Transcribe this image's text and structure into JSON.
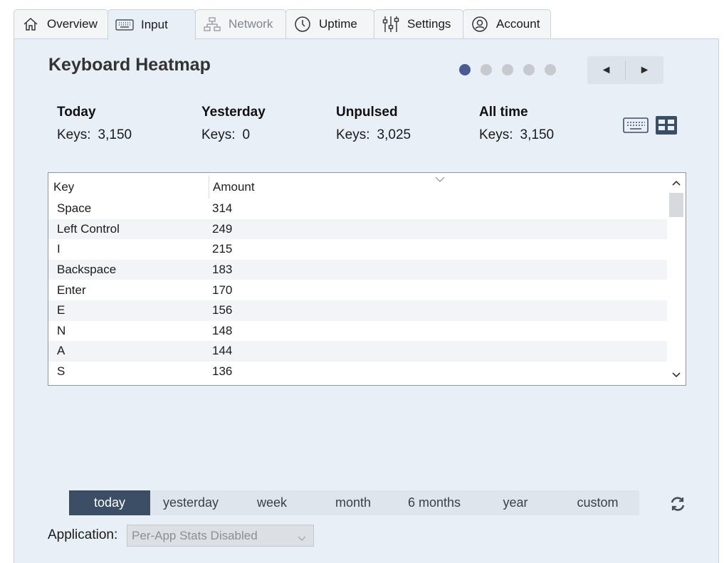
{
  "tabs": [
    {
      "label": "Overview",
      "icon": "home-icon",
      "state": "normal"
    },
    {
      "label": "Input",
      "icon": "keyboard-icon",
      "state": "active"
    },
    {
      "label": "Network",
      "icon": "network-icon",
      "state": "disabled"
    },
    {
      "label": "Uptime",
      "icon": "clock-icon",
      "state": "normal"
    },
    {
      "label": "Settings",
      "icon": "sliders-icon",
      "state": "normal"
    },
    {
      "label": "Account",
      "icon": "user-icon",
      "state": "normal"
    }
  ],
  "page": {
    "title": "Keyboard Heatmap",
    "pager_dots": {
      "count": 5,
      "active_index": 0
    },
    "prev_label": "◄",
    "next_label": "►"
  },
  "stats": [
    {
      "heading": "Today",
      "label": "Keys:",
      "value": "3,150"
    },
    {
      "heading": "Yesterday",
      "label": "Keys:",
      "value": "0"
    },
    {
      "heading": "Unpulsed",
      "label": "Keys:",
      "value": "3,025"
    },
    {
      "heading": "All time",
      "label": "Keys:",
      "value": "3,150"
    }
  ],
  "view_toggle": {
    "keyboard_view_icon": "keyboard-icon",
    "table_view_icon": "grid-icon",
    "active": "table"
  },
  "table": {
    "columns": [
      "Key",
      "Amount"
    ],
    "sort_column": "Amount",
    "sort_direction": "descending",
    "rows": [
      {
        "key": "Space",
        "amount": "314"
      },
      {
        "key": "Left Control",
        "amount": "249"
      },
      {
        "key": "I",
        "amount": "215"
      },
      {
        "key": "Backspace",
        "amount": "183"
      },
      {
        "key": "Enter",
        "amount": "170"
      },
      {
        "key": "E",
        "amount": "156"
      },
      {
        "key": "N",
        "amount": "148"
      },
      {
        "key": "A",
        "amount": "144"
      },
      {
        "key": "S",
        "amount": "136"
      }
    ]
  },
  "ranges": {
    "items": [
      "today",
      "yesterday",
      "week",
      "month",
      "6 months",
      "year",
      "custom"
    ],
    "active": "today"
  },
  "application": {
    "label": "Application:",
    "selected": "Per-App Stats Disabled",
    "disabled": true
  },
  "colors": {
    "panel_bg": "#e9eff6",
    "accent_dark": "#3c4e66",
    "dot_active": "#4b5a93",
    "dot_inactive": "#c6cacf"
  }
}
